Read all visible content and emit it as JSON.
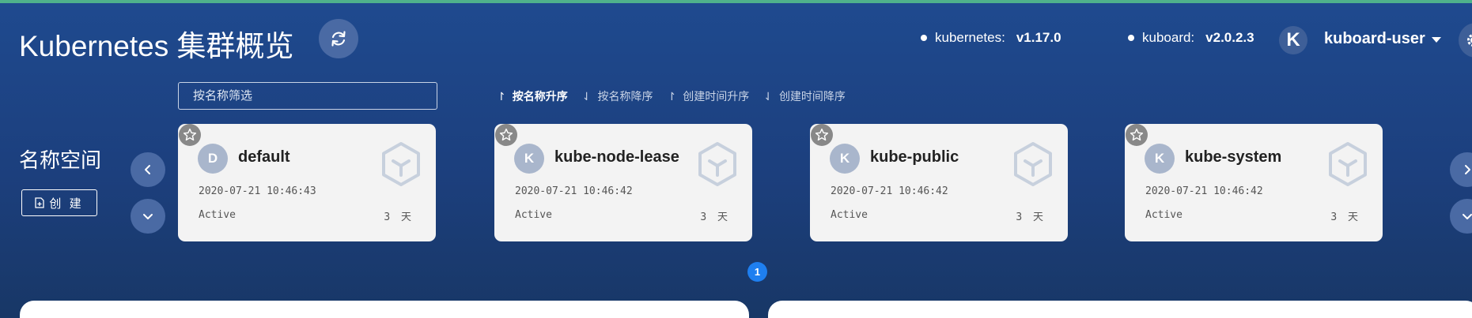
{
  "header": {
    "title": "Kubernetes 集群概览",
    "kubernetes_label": "kubernetes:",
    "kubernetes_version": "v1.17.0",
    "kuboard_label": "kuboard:",
    "kuboard_version": "v2.0.2.3",
    "avatar_letter": "K",
    "user_name": "kuboard-user",
    "icons": [
      "refresh-icon",
      "caret-down-icon",
      "gear-icon"
    ]
  },
  "namespaces": {
    "section_title": "名称空间",
    "create_label": "创 建",
    "filter_placeholder": "按名称筛选",
    "sort_options": [
      {
        "arrow": "↾",
        "label": "按名称升序",
        "active": true
      },
      {
        "arrow": "⇃",
        "label": "按名称降序",
        "active": false
      },
      {
        "arrow": "↾",
        "label": "创建时间升序",
        "active": false
      },
      {
        "arrow": "⇃",
        "label": "创建时间降序",
        "active": false
      }
    ],
    "cards": [
      {
        "letter": "D",
        "name": "default",
        "created": "2020-07-21 10:46:43",
        "status": "Active",
        "age": "3 天"
      },
      {
        "letter": "K",
        "name": "kube-node-lease",
        "created": "2020-07-21 10:46:42",
        "status": "Active",
        "age": "3 天"
      },
      {
        "letter": "K",
        "name": "kube-public",
        "created": "2020-07-21 10:46:42",
        "status": "Active",
        "age": "3 天"
      },
      {
        "letter": "K",
        "name": "kube-system",
        "created": "2020-07-21 10:46:42",
        "status": "Active",
        "age": "3 天"
      }
    ],
    "current_page": "1"
  },
  "colors": {
    "background": "#1f4a8f",
    "card": "#f3f3f3",
    "page_badge": "#1e7ff0",
    "top_line": "#4fb28b"
  }
}
